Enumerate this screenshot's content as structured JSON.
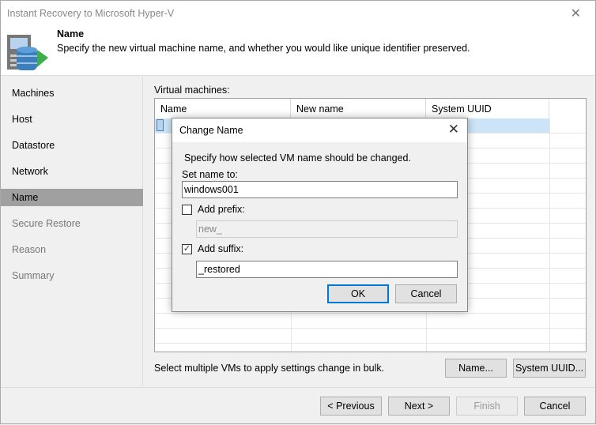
{
  "window": {
    "title": "Instant Recovery to Microsoft Hyper-V",
    "close": "✕"
  },
  "header": {
    "title": "Name",
    "description": "Specify the new virtual machine name, and whether you would like unique identifier preserved."
  },
  "nav": [
    {
      "label": "Machines"
    },
    {
      "label": "Host"
    },
    {
      "label": "Datastore"
    },
    {
      "label": "Network"
    },
    {
      "label": "Name",
      "active": true
    },
    {
      "label": "Secure Restore"
    },
    {
      "label": "Reason"
    },
    {
      "label": "Summary"
    }
  ],
  "main": {
    "label": "Virtual machines:",
    "columns": [
      "Name",
      "New name",
      "System UUID"
    ],
    "hint": "Select multiple VMs to apply settings change in bulk.",
    "name_button": "Name...",
    "uuid_button": "System UUID..."
  },
  "dialog": {
    "title": "Change Name",
    "close": "✕",
    "instruction": "Specify how selected VM name should be changed.",
    "set_name_label": "Set name to:",
    "set_name_value": "windows001",
    "prefix_label": "Add prefix:",
    "prefix_checked": false,
    "prefix_value": "new_",
    "suffix_label": "Add suffix:",
    "suffix_checked": true,
    "suffix_value": "_restored",
    "ok": "OK",
    "cancel": "Cancel",
    "check": "✓"
  },
  "footer": {
    "previous": "< Previous",
    "next": "Next >",
    "finish": "Finish",
    "cancel": "Cancel"
  }
}
